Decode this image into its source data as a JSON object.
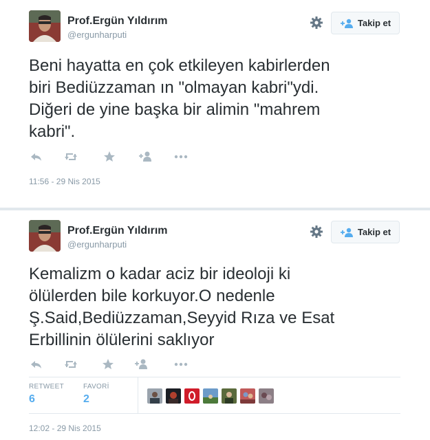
{
  "tweets": [
    {
      "author_name": "Prof.Ergün Yıldırım",
      "author_handle": "@ergunharputi",
      "follow_label": "Takip et",
      "text": "Beni hayatta en çok etkileyen kabirlerden\nbiri Bediüzzaman ın \"olmayan kabri\"ydi.\nDiğeri de yine başka bir alimin \"mahrem\nkabri\".",
      "timestamp": "11:56 - 29 Nis 2015"
    },
    {
      "author_name": "Prof.Ergün Yıldırım",
      "author_handle": "@ergunharputi",
      "follow_label": "Takip et",
      "text": "Kemalizm o kadar aciz bir ideoloji ki\nölülerden bile korkuyor.O nedenle\nŞ.Said,Bediüzzaman,Seyyid Rıza ve Esat\nErbillinin ölülerini saklıyor",
      "timestamp": "12:02 - 29 Nis 2015",
      "stats": {
        "retweet_label": "RETWEET",
        "retweet_count": "6",
        "favorite_label": "FAVORİ",
        "favorite_count": "2"
      }
    }
  ],
  "icons": [
    "gear-icon",
    "follow-person-icon",
    "reply-icon",
    "retweet-icon",
    "favorite-star-icon",
    "follow-add-icon",
    "more-dots-icon"
  ],
  "colors": {
    "accent": "#55acee",
    "text": "#292f33",
    "muted": "#8899a6",
    "action_gray": "#aab8c2",
    "separator": "#e1e8ed"
  }
}
